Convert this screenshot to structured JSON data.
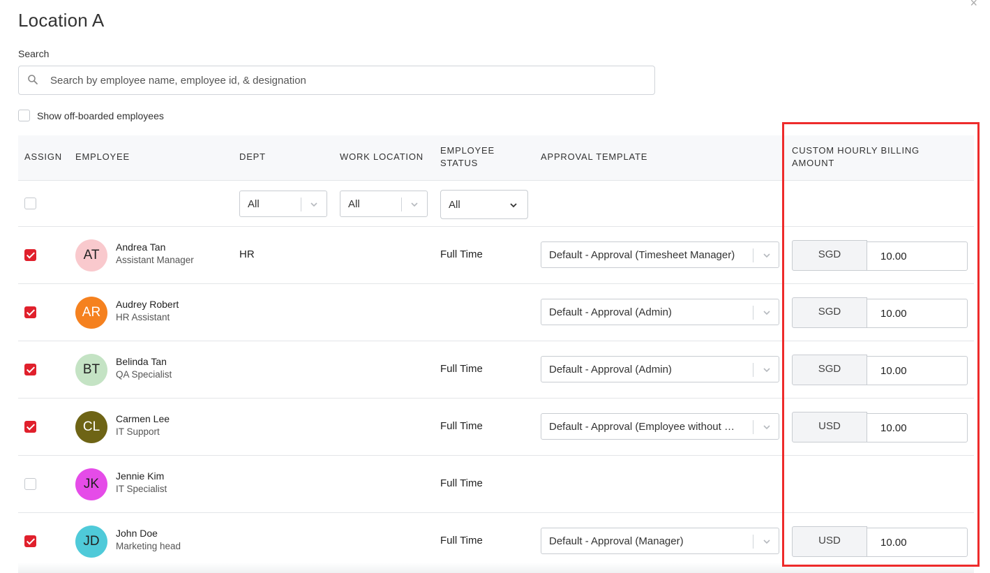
{
  "modal": {
    "title": "Location A",
    "close": "×"
  },
  "search": {
    "label": "Search",
    "placeholder": "Search by employee name, employee id, & designation"
  },
  "offboard": {
    "label": "Show off-boarded employees",
    "checked": false
  },
  "columns": {
    "assign": "ASSIGN",
    "employee": "EMPLOYEE",
    "dept": "DEPT",
    "work_location": "WORK LOCATION",
    "employee_status_1": "EMPLOYEE",
    "employee_status_2": "STATUS",
    "approval_template": "APPROVAL TEMPLATE",
    "billing_1": "CUSTOM HOURLY BILLING",
    "billing_2": "AMOUNT"
  },
  "filters": {
    "dept": "All",
    "work_location": "All",
    "employee_status": "All"
  },
  "rows": [
    {
      "initials": "AT",
      "name": "Andrea Tan",
      "title": "Assistant Manager",
      "dept": "HR",
      "status": "Full Time",
      "template": "Default - Approval (Timesheet Manager)",
      "currency": "SGD",
      "amount": "10.00",
      "avatar_color": "#f9c9cd",
      "checked": true
    },
    {
      "initials": "AR",
      "name": "Audrey Robert",
      "title": "HR Assistant",
      "dept": "",
      "status": "",
      "template": "Default - Approval (Admin)",
      "currency": "SGD",
      "amount": "10.00",
      "avatar_color": "#f5811f",
      "checked": true
    },
    {
      "initials": "BT",
      "name": "Belinda Tan",
      "title": "QA Specialist",
      "dept": "",
      "status": "Full Time",
      "template": "Default - Approval (Admin)",
      "currency": "SGD",
      "amount": "10.00",
      "avatar_color": "#c4e3c4",
      "checked": true
    },
    {
      "initials": "CL",
      "name": "Carmen Lee",
      "title": "IT Support",
      "dept": "",
      "status": "Full Time",
      "template": "Default - Approval (Employee without …",
      "currency": "USD",
      "amount": "10.00",
      "avatar_color": "#6e6415",
      "checked": true
    },
    {
      "initials": "JK",
      "name": "Jennie Kim",
      "title": "IT Specialist",
      "dept": "",
      "status": "Full Time",
      "template": "",
      "currency": "",
      "amount": "",
      "avatar_color": "#e54ce8",
      "checked": false
    },
    {
      "initials": "JD",
      "name": "John Doe",
      "title": "Marketing head",
      "dept": "",
      "status": "Full Time",
      "template": "Default - Approval (Manager)",
      "currency": "USD",
      "amount": "10.00",
      "avatar_color": "#4fcad9",
      "checked": true
    }
  ],
  "colors": {
    "accent_red": "#e0202c",
    "highlight_box": "#ee2b2b",
    "header_bg": "#f7f8fa"
  }
}
